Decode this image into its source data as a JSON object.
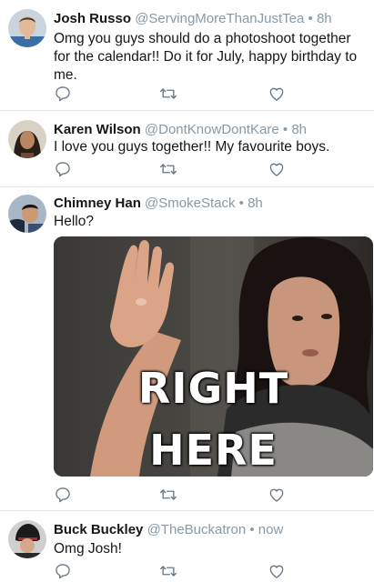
{
  "tweets": [
    {
      "name": "Josh Russo",
      "handle": "@ServingMoreThanJustTea",
      "separator": "•",
      "time": "8h",
      "text": "Omg you guys should do a photoshoot together for the calendar!! Do it for July, happy birthday to me."
    },
    {
      "name": "Karen Wilson",
      "handle": "@DontKnowDontKare",
      "separator": "•",
      "time": "8h",
      "text": "I love you guys together!! My favourite boys."
    },
    {
      "name": "Chimney Han",
      "handle": "@SmokeStack",
      "separator": "•",
      "time": "8h",
      "text": "Hello?",
      "media": {
        "caption_line1": "RIGHT",
        "caption_line2": "HERE"
      }
    },
    {
      "name": "Buck Buckley",
      "handle": "@TheBuckatron",
      "separator": "•",
      "time": "now",
      "text": "Omg Josh!"
    }
  ],
  "icons": {
    "reply": "reply-icon",
    "retweet": "retweet-icon",
    "like": "like-icon"
  },
  "colors": {
    "text": "#14171a",
    "secondary": "#8899a6",
    "divider": "#e1e8ed"
  }
}
